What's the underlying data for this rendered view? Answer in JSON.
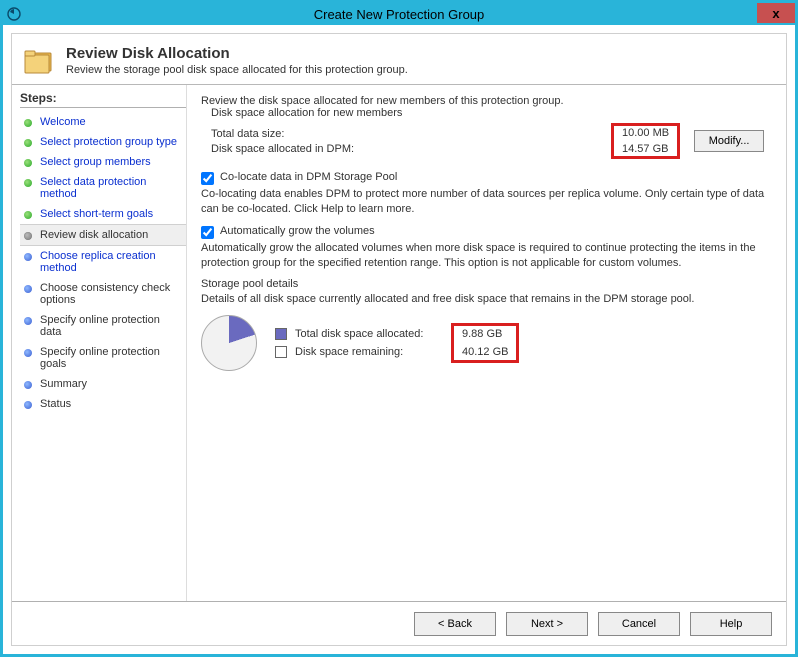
{
  "window": {
    "title": "Create New Protection Group",
    "close": "x"
  },
  "header": {
    "title": "Review Disk Allocation",
    "subtitle": "Review the storage pool disk space allocated for this protection group."
  },
  "sidebar": {
    "title": "Steps:",
    "items": [
      {
        "label": "Welcome",
        "style": "link",
        "bullet": "green"
      },
      {
        "label": "Select protection group type",
        "style": "link",
        "bullet": "green"
      },
      {
        "label": "Select group members",
        "style": "link",
        "bullet": "green"
      },
      {
        "label": "Select data protection method",
        "style": "link",
        "bullet": "green"
      },
      {
        "label": "Select short-term goals",
        "style": "link",
        "bullet": "green"
      },
      {
        "label": "Review disk allocation",
        "style": "current",
        "bullet": "grey"
      },
      {
        "label": "Choose replica creation method",
        "style": "link",
        "bullet": "blue"
      },
      {
        "label": "Choose consistency check options",
        "style": "plain",
        "bullet": "blue"
      },
      {
        "label": "Specify online protection data",
        "style": "plain",
        "bullet": "blue"
      },
      {
        "label": "Specify online protection goals",
        "style": "plain",
        "bullet": "blue"
      },
      {
        "label": "Summary",
        "style": "plain",
        "bullet": "blue"
      },
      {
        "label": "Status",
        "style": "plain",
        "bullet": "blue"
      }
    ]
  },
  "content": {
    "intro": "Review the disk space allocated for new members of this protection group.",
    "alloc": {
      "group_title": "Disk space allocation for new members",
      "total_label": "Total data size:",
      "total_value": "10.00 MB",
      "dpm_label": "Disk space allocated in DPM:",
      "dpm_value": "14.57 GB",
      "modify": "Modify..."
    },
    "colocate": {
      "label": "Co-locate data in DPM Storage Pool",
      "desc": "Co-locating data enables DPM to protect more number of data sources per replica volume. Only certain type of data can be co-located. Click Help to learn more."
    },
    "autogrow": {
      "label": "Automatically grow the volumes",
      "desc": "Automatically grow the allocated volumes when more disk space is required to continue protecting the items in the protection group for the specified retention range. This option is not applicable for custom volumes."
    },
    "pool": {
      "group_title": "Storage pool details",
      "desc": "Details of all disk space currently allocated and free disk space that remains in the DPM storage pool.",
      "allocated_label": "Total disk space allocated:",
      "allocated_value": "9.88 GB",
      "remaining_label": "Disk space remaining:",
      "remaining_value": "40.12 GB"
    }
  },
  "footer": {
    "back": "< Back",
    "next": "Next >",
    "cancel": "Cancel",
    "help": "Help"
  }
}
